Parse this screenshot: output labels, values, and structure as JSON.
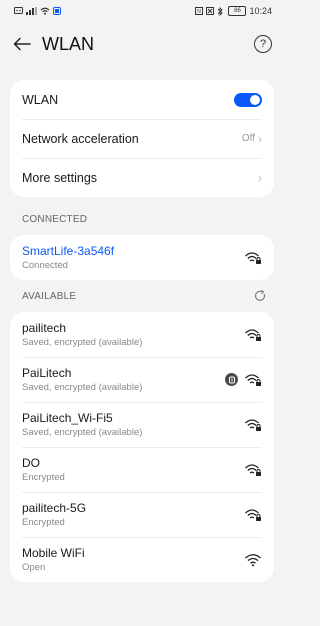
{
  "status_bar": {
    "time": "10:24",
    "battery": "86"
  },
  "header": {
    "title": "WLAN",
    "help_symbol": "?"
  },
  "settings": {
    "wlan_label": "WLAN",
    "wlan_enabled": true,
    "acceleration_label": "Network acceleration",
    "acceleration_value": "Off",
    "more_label": "More settings"
  },
  "connected": {
    "header": "CONNECTED",
    "network": {
      "name": "SmartLife-3a546f",
      "status": "Connected"
    }
  },
  "available": {
    "header": "AVAILABLE",
    "networks": [
      {
        "name": "pailitech",
        "status": "Saved, encrypted (available)"
      },
      {
        "name": "PaiLitech",
        "status": "Saved, encrypted (available)"
      },
      {
        "name": "PaiLitech_Wi-Fi5",
        "status": "Saved, encrypted (available)"
      },
      {
        "name": "DO",
        "status": "Encrypted"
      },
      {
        "name": "pailitech-5G",
        "status": "Encrypted"
      },
      {
        "name": "Mobile WiFi",
        "status": "Open"
      }
    ]
  },
  "colors": {
    "accent": "#0a59f7",
    "background": "#f1f3f5"
  },
  "icons": {
    "back": "arrow-left-icon",
    "help": "help-icon",
    "refresh": "refresh-icon",
    "wifi_locked": "wifi-locked-icon",
    "wifi_open": "wifi-icon",
    "badge": "hotspot-badge-icon"
  }
}
